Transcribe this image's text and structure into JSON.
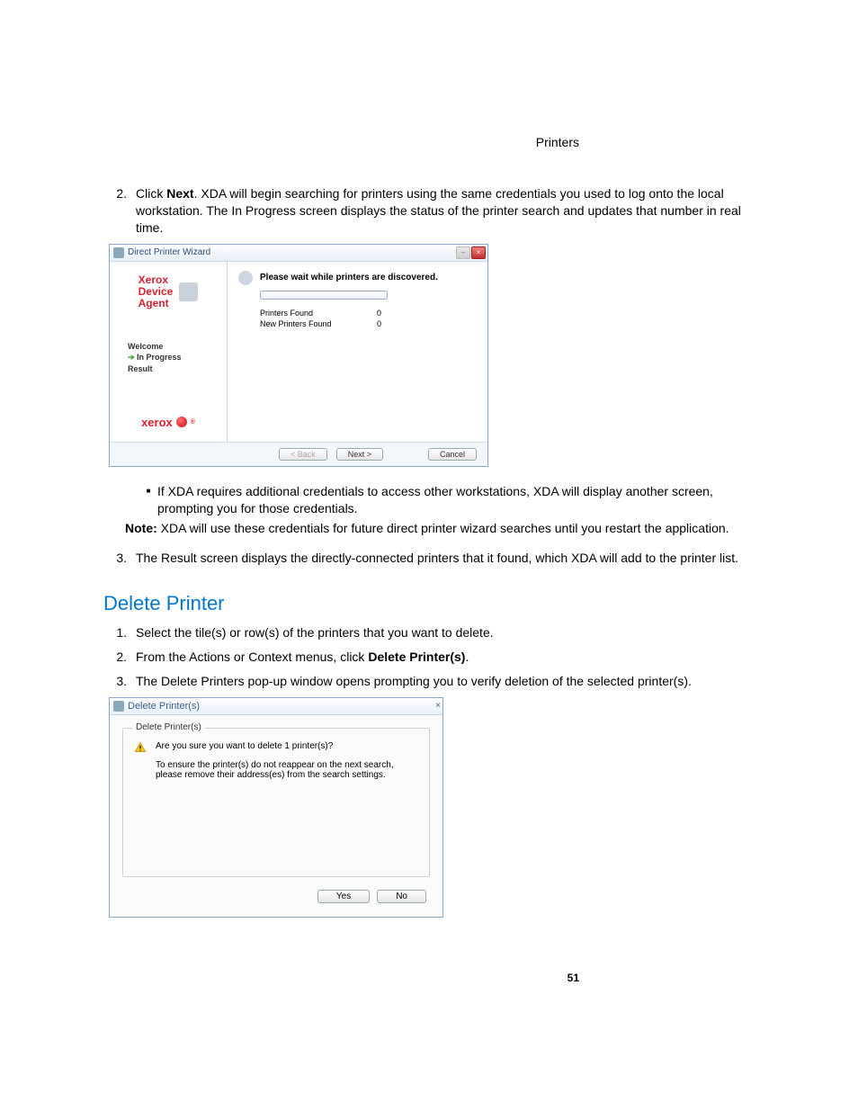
{
  "header": {
    "section": "Printers"
  },
  "step2": {
    "num": "2.",
    "line1_a": "Click ",
    "line1_bold": "Next",
    "line1_b": ". XDA will begin searching for printers using the same credentials you used to log onto the local workstation. The In Progress screen displays the status of the printer search and updates that number in real time."
  },
  "wizard": {
    "title": "Direct Printer Wizard",
    "brand_l1": "Xerox",
    "brand_l2": "Device",
    "brand_l3": "Agent",
    "steps": {
      "s1": "Welcome",
      "s2": "In Progress",
      "s3": "Result"
    },
    "logo": "xerox",
    "heading": "Please wait while printers are discovered.",
    "row1_lbl": "Printers Found",
    "row1_val": "0",
    "row2_lbl": "New Printers Found",
    "row2_val": "0",
    "btn_back": "< Back",
    "btn_next": "Next >",
    "btn_cancel": "Cancel"
  },
  "sub": {
    "text": "If XDA requires additional credentials to access other workstations, XDA will display another screen, prompting you for those credentials."
  },
  "note": {
    "bold": "Note:",
    "text": " XDA will use these credentials for future direct printer wizard searches until you restart the application."
  },
  "step3": {
    "num": "3.",
    "text": "The Result screen displays the directly-connected printers that it found, which XDA will add to the printer list."
  },
  "heading_delete": "Delete Printer",
  "dstep1": {
    "num": "1.",
    "text": "Select the tile(s) or row(s) of the printers that you want to delete."
  },
  "dstep2": {
    "num": "2.",
    "text_a": "From the Actions or Context menus, click ",
    "bold": "Delete Printer(s)",
    "text_b": "."
  },
  "dstep3": {
    "num": "3.",
    "text": "The Delete Printers pop-up window opens prompting you to verify deletion of the selected printer(s)."
  },
  "dialog": {
    "title": "Delete Printer(s)",
    "legend": "Delete Printer(s)",
    "question": "Are you sure you want to delete 1 printer(s)?",
    "info": "To ensure the printer(s) do not reappear on the next search, please remove their address(es) from the search settings.",
    "yes": "Yes",
    "no": "No"
  },
  "page_number": "51"
}
